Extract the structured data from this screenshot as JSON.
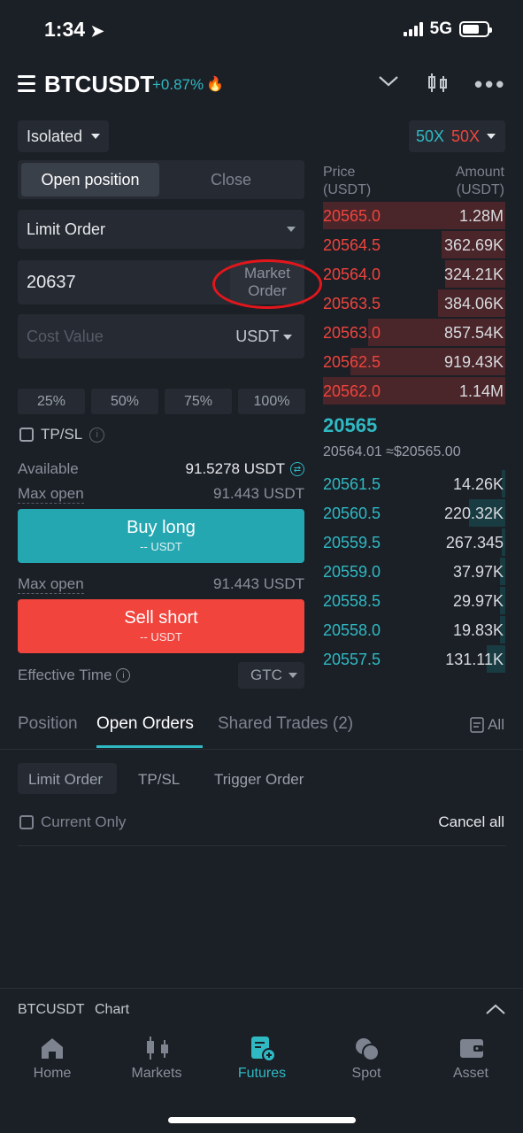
{
  "status_bar": {
    "time": "1:34",
    "network": "5G"
  },
  "header": {
    "pair": "BTCUSDT",
    "change": "+0.87%"
  },
  "margin_mode": {
    "value": "Isolated"
  },
  "leverage": {
    "long": "50X",
    "short": "50X"
  },
  "position_tabs": {
    "open": "Open position",
    "close": "Close"
  },
  "order_type": {
    "value": "Limit Order"
  },
  "price_input": {
    "value": "20637",
    "market_order_label_1": "Market",
    "market_order_label_2": "Order"
  },
  "cost_input": {
    "placeholder": "Cost Value",
    "unit": "USDT"
  },
  "percent_buttons": [
    "25%",
    "50%",
    "75%",
    "100%"
  ],
  "tpsl": {
    "label": "TP/SL"
  },
  "available": {
    "label": "Available",
    "value": "91.5278 USDT"
  },
  "max_open_long": {
    "label": "Max open",
    "value": "91.443 USDT"
  },
  "buy_button": {
    "label": "Buy long",
    "sub": "-- USDT"
  },
  "max_open_short": {
    "label": "Max open",
    "value": "91.443 USDT"
  },
  "sell_button": {
    "label": "Sell short",
    "sub": "-- USDT"
  },
  "effective_time": {
    "label": "Effective Time",
    "value": "GTC"
  },
  "orderbook": {
    "price_header_1": "Price",
    "price_header_2": "(USDT)",
    "amount_header_1": "Amount",
    "amount_header_2": "(USDT)",
    "asks": [
      {
        "price": "20565.0",
        "amount": "1.28M",
        "depth": 1.0
      },
      {
        "price": "20564.5",
        "amount": "362.69K",
        "depth": 0.35
      },
      {
        "price": "20564.0",
        "amount": "324.21K",
        "depth": 0.33
      },
      {
        "price": "20563.5",
        "amount": "384.06K",
        "depth": 0.37
      },
      {
        "price": "20563.0",
        "amount": "857.54K",
        "depth": 0.75
      },
      {
        "price": "20562.5",
        "amount": "919.43K",
        "depth": 0.85
      },
      {
        "price": "20562.0",
        "amount": "1.14M",
        "depth": 1.0
      }
    ],
    "last_price": "20565",
    "mark_price": "20564.01 ≈$20565.00",
    "bids": [
      {
        "price": "20561.5",
        "amount": "14.26K",
        "depth": 0.02
      },
      {
        "price": "20560.5",
        "amount": "220.32K",
        "depth": 0.2
      },
      {
        "price": "20559.5",
        "amount": "267.345",
        "depth": 0.02
      },
      {
        "price": "20559.0",
        "amount": "37.97K",
        "depth": 0.03
      },
      {
        "price": "20558.5",
        "amount": "29.97K",
        "depth": 0.03
      },
      {
        "price": "20558.0",
        "amount": "19.83K",
        "depth": 0.03
      },
      {
        "price": "20557.5",
        "amount": "131.11K",
        "depth": 0.1
      }
    ]
  },
  "bottom_tabs": {
    "position": "Position",
    "open_orders": "Open Orders",
    "shared_trades": "Shared Trades (2)",
    "all": "All"
  },
  "order_filters": {
    "limit": "Limit Order",
    "tpsl": "TP/SL",
    "trigger": "Trigger Order"
  },
  "current_only": {
    "label": "Current Only"
  },
  "cancel_all": {
    "label": "Cancel all"
  },
  "chart_bar": {
    "pair": "BTCUSDT",
    "chart": "Chart"
  },
  "bottom_nav": [
    {
      "label": "Home",
      "icon": "home-icon"
    },
    {
      "label": "Markets",
      "icon": "candles-icon"
    },
    {
      "label": "Futures",
      "icon": "futures-icon"
    },
    {
      "label": "Spot",
      "icon": "spot-icon"
    },
    {
      "label": "Asset",
      "icon": "wallet-icon"
    }
  ],
  "colors": {
    "teal": "#2fb9c3",
    "red": "#f0443d",
    "background": "#1b1f26"
  }
}
